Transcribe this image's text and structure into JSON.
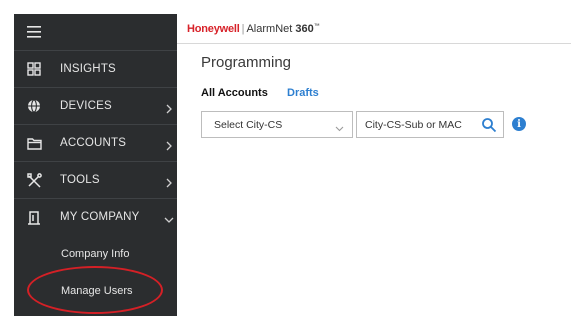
{
  "sidebar": {
    "items": [
      {
        "label": "INSIGHTS",
        "icon": "grid-icon"
      },
      {
        "label": "DEVICES",
        "icon": "globe-icon"
      },
      {
        "label": "ACCOUNTS",
        "icon": "folder-icon"
      },
      {
        "label": "TOOLS",
        "icon": "tools-icon"
      },
      {
        "label": "MY COMPANY",
        "icon": "building-icon"
      }
    ],
    "subitems": [
      {
        "label": "Company Info"
      },
      {
        "label": "Manage Users"
      }
    ]
  },
  "header": {
    "brand": "Honeywell",
    "separator": "|",
    "product_prefix": "AlarmNet ",
    "product_bold": "360",
    "product_mark": "™"
  },
  "page": {
    "title": "Programming",
    "tabs": [
      "All Accounts",
      "Drafts"
    ],
    "select_value": "Select City-CS",
    "search_placeholder": "City-CS-Sub or MAC",
    "info_glyph": "i"
  },
  "colors": {
    "sidebar_bg": "#2b2d2f",
    "brand_red": "#d8232a",
    "link_blue": "#2d7fd0",
    "highlight_ring": "#d42026"
  }
}
